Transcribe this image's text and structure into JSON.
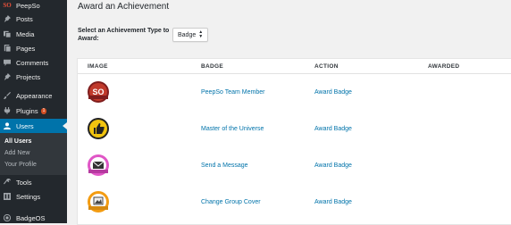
{
  "sidebar": {
    "items": [
      {
        "label": "PeepSo",
        "icon": "peepso-icon"
      },
      {
        "label": "Posts",
        "icon": "pin-icon"
      },
      {
        "label": "Media",
        "icon": "media-icon"
      },
      {
        "label": "Pages",
        "icon": "page-icon"
      },
      {
        "label": "Comments",
        "icon": "comment-icon"
      },
      {
        "label": "Projects",
        "icon": "pin-icon"
      },
      {
        "label": "Appearance",
        "icon": "brush-icon"
      },
      {
        "label": "Plugins",
        "icon": "plug-icon",
        "count": "1"
      },
      {
        "label": "Users",
        "icon": "user-icon",
        "current": true
      },
      {
        "label": "Tools",
        "icon": "wrench-icon"
      },
      {
        "label": "Settings",
        "icon": "settings-icon"
      },
      {
        "label": "BadgeOS",
        "icon": "badgeos-icon"
      }
    ],
    "submenu": [
      "All Users",
      "Add New",
      "Your Profile"
    ]
  },
  "main": {
    "title": "Award an Achievement",
    "type_label": "Select an Achievement Type to Award:",
    "type_select_value": "Badge",
    "columns": [
      "IMAGE",
      "BADGE",
      "ACTION",
      "AWARDED"
    ],
    "rows": [
      {
        "badge": "PeepSo Team Member",
        "action": "Award Badge",
        "icon": "peepso-badge-icon",
        "color": "#c0392b"
      },
      {
        "badge": "Master of the Universe",
        "action": "Award Badge",
        "icon": "thumbs-up-badge-icon",
        "color": "#f1c40f"
      },
      {
        "badge": "Send a Message",
        "action": "Award Badge",
        "icon": "envelope-badge-icon",
        "color": "#e056c6"
      },
      {
        "badge": "Change Group Cover",
        "action": "Award Badge",
        "icon": "cover-badge-icon",
        "color": "#f39c12"
      }
    ]
  },
  "colors": {
    "sidebar_bg": "#23282d",
    "accent": "#0073aa",
    "link": "#0073aa",
    "update_badge": "#d54e21"
  }
}
